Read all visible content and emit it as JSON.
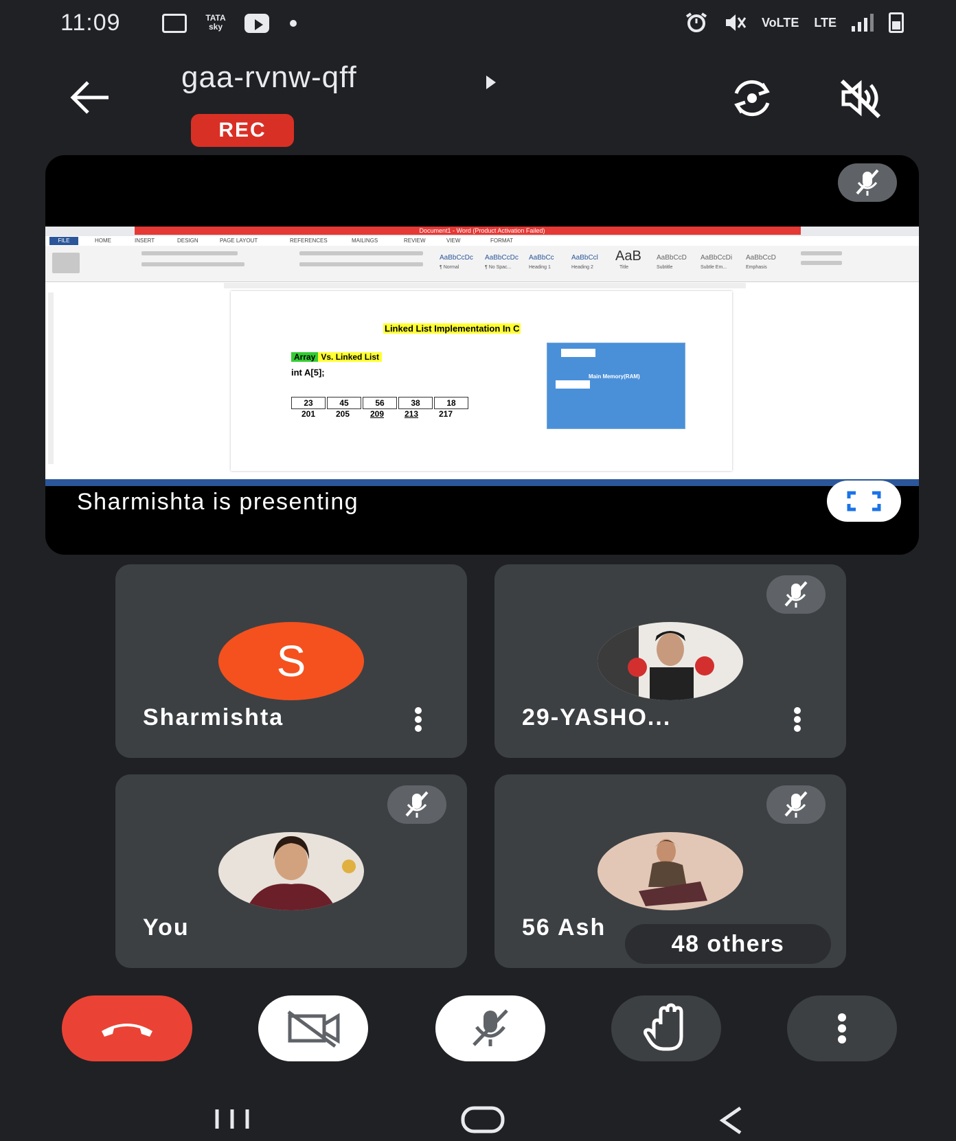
{
  "status_bar": {
    "time": "11:09",
    "left_icons": [
      "gallery-icon",
      "tata-sky-icon",
      "youtube-icon",
      "notification-dot"
    ],
    "tata_label": "TATA\nsky",
    "right_text": [
      "VoLTE",
      "LTE"
    ],
    "right_icons": [
      "alarm-icon",
      "mute-icon",
      "volte-icon",
      "lte-icon",
      "signal-icon",
      "battery-icon"
    ]
  },
  "header": {
    "meeting_code": "gaa-rvnw-qff",
    "rec_label": "REC",
    "icons": [
      "back-arrow-icon",
      "switch-camera-icon",
      "speaker-off-icon"
    ]
  },
  "presentation": {
    "presenting_text": "Sharmishta is presenting",
    "word_window_title": "Document1 - Word (Product Activation Failed)",
    "doc_title": "Linked List Implementation In C",
    "doc_array_label": "Array",
    "doc_vs_label": "Vs. Linked List",
    "doc_code": "int A[5];",
    "array_values": [
      "23",
      "45",
      "56",
      "38",
      "18"
    ],
    "array_addresses": [
      "201",
      "205",
      "209",
      "213",
      "217"
    ],
    "memory_label": "Main Memory(RAM)",
    "fullscreen_icon": "fullscreen-icon",
    "mic_icon": "mic-off-icon",
    "ribbon_styles": [
      "AaBbCcDc",
      "AaBbCcDc",
      "AaBbCc",
      "AaBbCcl",
      "AaB",
      "AaBbCcD",
      "AaBbCcDi",
      "AaBbCcD"
    ],
    "ribbon_style_names": [
      "¶ Normal",
      "¶ No Spac...",
      "Heading 1",
      "Heading 2",
      "Title",
      "Subtitle",
      "Subtle Em...",
      "Emphasis"
    ],
    "word_tabs": [
      "FILE",
      "HOME",
      "INSERT",
      "DESIGN",
      "PAGE LAYOUT",
      "REFERENCES",
      "MAILINGS",
      "REVIEW",
      "VIEW",
      "FORMAT"
    ]
  },
  "participants": [
    {
      "name": "Sharmishta",
      "avatar_letter": "S",
      "avatar_color": "#f4511e",
      "muted": false
    },
    {
      "name": "29-YASHO...",
      "avatar": "photo",
      "muted": true
    },
    {
      "name": "You",
      "avatar": "photo",
      "muted": true
    },
    {
      "name": "56 Ash",
      "avatar": "photo",
      "muted": true,
      "others_label": "48 others"
    }
  ],
  "controls": [
    {
      "name": "end-call-button",
      "icon": "phone-hangup-icon",
      "color": "#ea4335"
    },
    {
      "name": "camera-toggle-button",
      "icon": "camera-off-icon",
      "color": "#ffffff"
    },
    {
      "name": "mic-toggle-button",
      "icon": "mic-off-icon",
      "color": "#ffffff"
    },
    {
      "name": "raise-hand-button",
      "icon": "raise-hand-icon",
      "color": "#3c4043"
    },
    {
      "name": "more-options-button",
      "icon": "more-vert-icon",
      "color": "#3c4043"
    }
  ],
  "nav_bar": [
    "recents-icon",
    "home-icon",
    "back-icon"
  ],
  "colors": {
    "background": "#202124",
    "tile": "#3c4043",
    "rec": "#d93025",
    "hangup": "#ea4335",
    "accent_blue": "#1a73e8"
  }
}
